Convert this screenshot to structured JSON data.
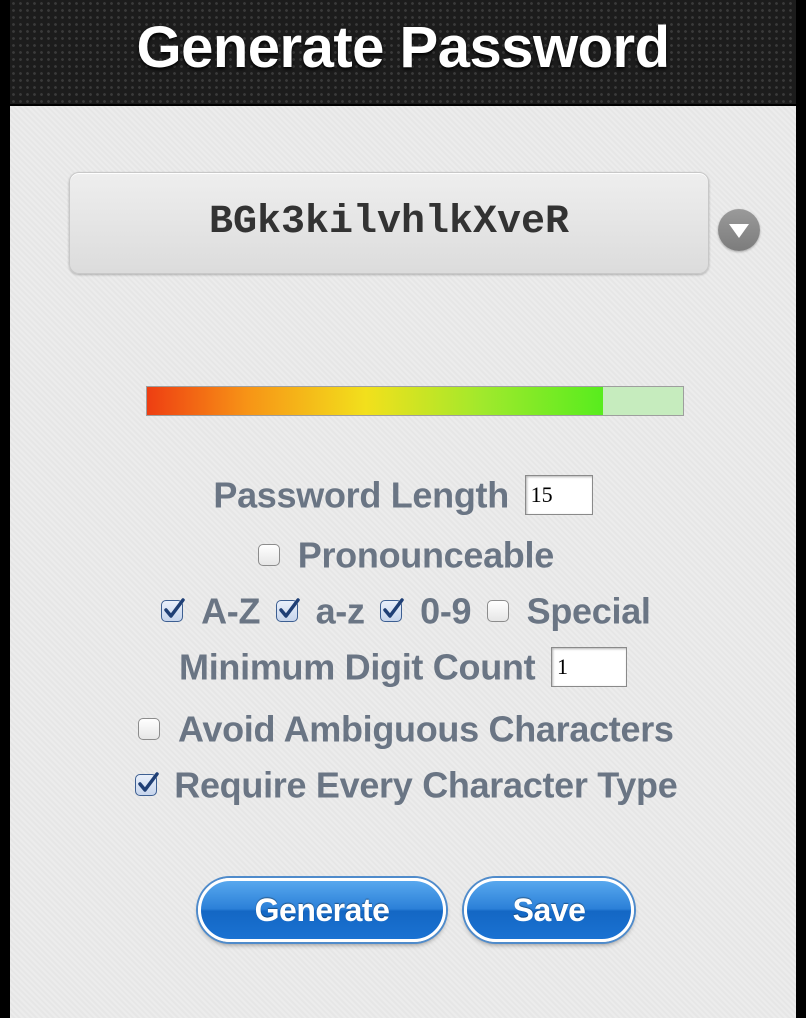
{
  "header": {
    "title": "Generate Password"
  },
  "password": {
    "value": "BGk3kilvhlkXveR",
    "dropdown_icon": "chevron-down-icon"
  },
  "strength": {
    "fraction": 0.85
  },
  "options": {
    "length_label": "Password Length",
    "length_value": "15",
    "pronounceable_label": "Pronounceable",
    "pronounceable_checked": false,
    "upper_label": "A-Z",
    "upper_checked": true,
    "lower_label": "a-z",
    "lower_checked": true,
    "digits_label": "0-9",
    "digits_checked": true,
    "special_label": "Special",
    "special_checked": false,
    "min_digit_label": "Minimum Digit Count",
    "min_digit_value": "1",
    "avoid_ambiguous_label": "Avoid Ambiguous Characters",
    "avoid_ambiguous_checked": false,
    "require_every_label": "Require Every Character Type",
    "require_every_checked": true
  },
  "buttons": {
    "generate": "Generate",
    "save": "Save"
  },
  "colors": {
    "accent": "#2b80d8",
    "label": "#6a7584",
    "title_bar": "#1c1c1c"
  }
}
